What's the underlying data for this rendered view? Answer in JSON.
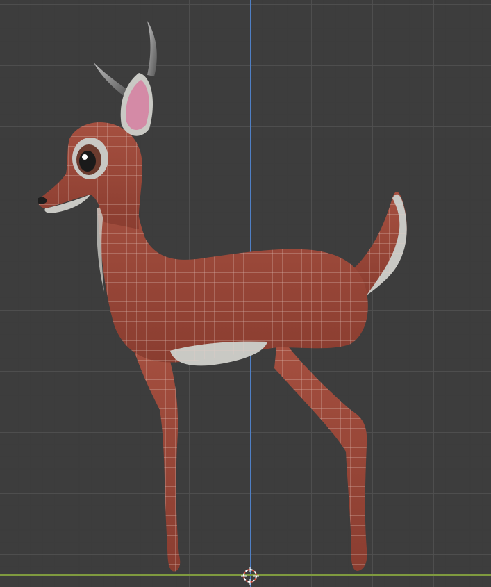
{
  "viewport": {
    "view": "side-orthographic",
    "background_color": "#3d3d3d",
    "grid_color": "#505050",
    "axis_z_color": "#4f7fc4",
    "axis_x_color": "#7f9a3f"
  },
  "model": {
    "icon": "deer-mesh-icon",
    "body_color": "#9e4a3a",
    "belly_color": "#c9c9c4",
    "ear_inner_color": "#d48aa6",
    "horn_color": "#6a6a6a",
    "wireframe_color": "#e8d0c8"
  },
  "cursor_3d": {
    "icon": "3d-cursor-icon",
    "ring_color": "#d94a3a"
  }
}
